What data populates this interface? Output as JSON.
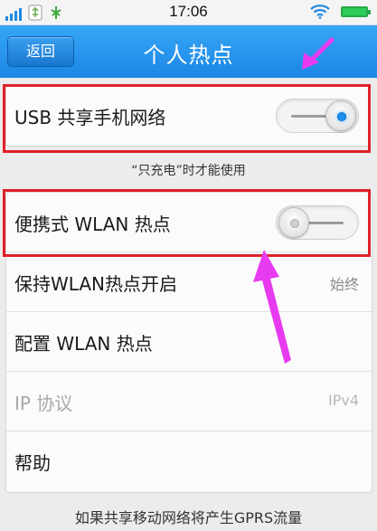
{
  "status_bar": {
    "time": "17:06",
    "icons": [
      "signal-icon",
      "usb-icon",
      "android-debug-icon",
      "wifi-icon",
      "battery-icon"
    ]
  },
  "header": {
    "back_label": "返回",
    "title": "个人热点"
  },
  "usb_tethering": {
    "label": "USB 共享手机网络",
    "enabled": true
  },
  "usb_note": "“只充电”时才能使用",
  "hotspot": {
    "label": "便携式 WLAN 热点",
    "enabled": false
  },
  "settings": [
    {
      "label": "保持WLAN热点开启",
      "value": "始终"
    },
    {
      "label": "配置 WLAN 热点",
      "value": ""
    },
    {
      "label": "IP 协议",
      "value": "IPv4"
    },
    {
      "label": "帮助",
      "value": ""
    }
  ],
  "bottom_note": "如果共享移动网络将产生GPRS流量",
  "colors": {
    "header": "#1b86e6",
    "highlight": "#e0202a",
    "arrow": "#e83bf0",
    "toggle_on": "#1e8ff0"
  }
}
